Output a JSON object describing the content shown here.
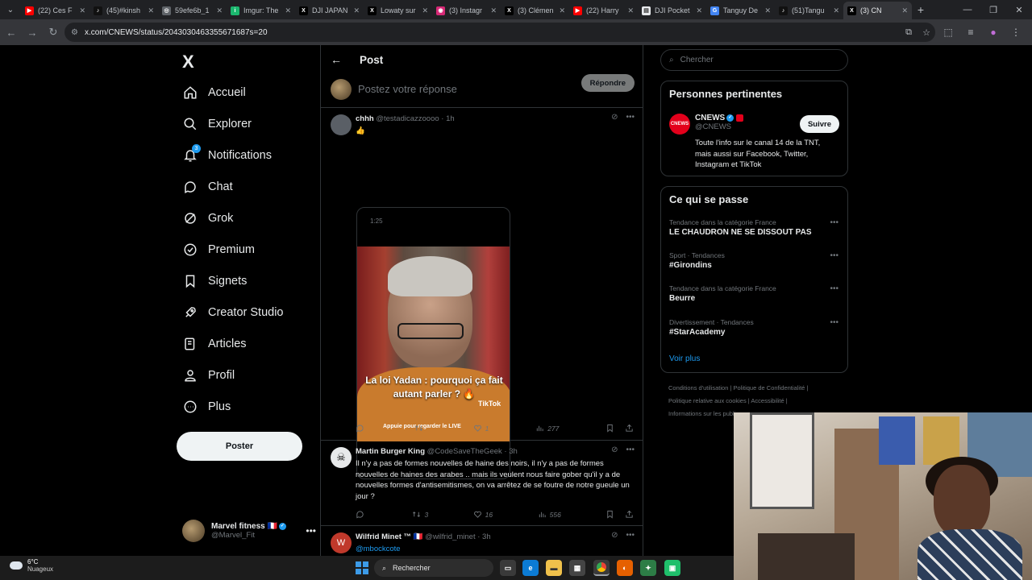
{
  "browser": {
    "tabs": [
      {
        "title": "(22) Ces F",
        "favicon": "youtube",
        "color": "#ff0000",
        "glyph": "▶"
      },
      {
        "title": "(45)#kinsh",
        "favicon": "tiktok",
        "color": "#111111",
        "glyph": "♪"
      },
      {
        "title": "59efe6b_1",
        "favicon": "globe",
        "color": "#5f6368",
        "glyph": "◎"
      },
      {
        "title": "Imgur: The",
        "favicon": "imgur",
        "color": "#1bb76e",
        "glyph": "i"
      },
      {
        "title": "DJI JAPAN",
        "favicon": "x",
        "color": "#000000",
        "glyph": "X"
      },
      {
        "title": "Lowaty sur",
        "favicon": "x",
        "color": "#000000",
        "glyph": "X"
      },
      {
        "title": "(3) Instagr",
        "favicon": "instagram",
        "color": "#d62976",
        "glyph": "◉"
      },
      {
        "title": "(3) Clémen",
        "favicon": "x",
        "color": "#000000",
        "glyph": "X"
      },
      {
        "title": "(22) Harry",
        "favicon": "youtube",
        "color": "#ff0000",
        "glyph": "▶"
      },
      {
        "title": "DJI Pocket",
        "favicon": "doc",
        "color": "#e8eaed",
        "glyph": "▤"
      },
      {
        "title": "Tanguy De",
        "favicon": "google",
        "color": "#4285f4",
        "glyph": "G"
      },
      {
        "title": "(51)Tangu",
        "favicon": "tiktok",
        "color": "#111111",
        "glyph": "♪"
      },
      {
        "title": "(3) CN",
        "favicon": "x",
        "color": "#000000",
        "glyph": "X",
        "active": true
      }
    ],
    "url": "x.com/CNEWS/status/2043030463355671687s=20",
    "new_tab": "+"
  },
  "nav": {
    "logo": "X",
    "notification_count": "3",
    "items": [
      {
        "label": "Accueil",
        "icon": "home-icon"
      },
      {
        "label": "Explorer",
        "icon": "search-icon"
      },
      {
        "label": "Notifications",
        "icon": "bell-icon"
      },
      {
        "label": "Chat",
        "icon": "chat-icon"
      },
      {
        "label": "Grok",
        "icon": "grok-icon"
      },
      {
        "label": "Premium",
        "icon": "premium-icon"
      },
      {
        "label": "Signets",
        "icon": "bookmark-icon"
      },
      {
        "label": "Creator Studio",
        "icon": "rocket-icon"
      },
      {
        "label": "Articles",
        "icon": "article-icon"
      },
      {
        "label": "Profil",
        "icon": "profile-icon"
      },
      {
        "label": "Plus",
        "icon": "more-icon"
      }
    ],
    "post_button": "Poster",
    "account": {
      "name": "Marvel fitness",
      "handle": "@Marvel_Fit",
      "flag": "🇫🇷"
    }
  },
  "center": {
    "header_title": "Post",
    "reply_placeholder": "Postez votre réponse",
    "reply_button": "Répondre",
    "tweets": [
      {
        "author": "chhh",
        "handle": "@testadicazzoooo",
        "time": "· 1h",
        "text": "👍",
        "video_duration": "1:25",
        "caption": "La loi Yadan : pourquoi ça fait autant parler ? 🔥",
        "tiktok_label": "TikTok",
        "live_label": "Appuie pour regarder le LIVE",
        "stats": {
          "replies": "",
          "reposts": "",
          "likes": "1",
          "views": "277"
        }
      },
      {
        "author": "Martin Burger King",
        "handle": "@CodeSaveTheGeek",
        "time": "· 3h",
        "text": "Il n'y a pas de formes nouvelles de haine des noirs, il n'y a pas de formes nouvelles de haines des arabes .. mais ils veulent nous faire gober qu'il y a de nouvelles formes d'antisemitismes, on va arrêtez de se foutre de notre gueule un jour ?",
        "stats": {
          "replies": "",
          "reposts": "3",
          "likes": "16",
          "views": "556"
        }
      },
      {
        "author": "Wilfrid Minet ™",
        "handle": "@wilfrid_minet",
        "time": "· 3h",
        "text": "@mbockcote",
        "avatar_letter": "W",
        "flag": "🇫🇷"
      }
    ]
  },
  "right": {
    "search_placeholder": "Chercher",
    "relevant": {
      "title": "Personnes pertinentes",
      "name": "CNEWS",
      "handle": "@CNEWS",
      "bio": "Toute l'info sur le canal 14 de la TNT, mais aussi sur Facebook, Twitter, Instagram et TikTok",
      "follow": "Suivre",
      "logo_text": "CNEWS"
    },
    "happening": {
      "title": "Ce qui se passe",
      "trends": [
        {
          "context": "Tendance dans la catégorie France",
          "name": "LE CHAUDRON NE SE DISSOUT PAS"
        },
        {
          "context": "Sport · Tendances",
          "name": "#Girondins"
        },
        {
          "context": "Tendance dans la catégorie France",
          "name": "Beurre"
        },
        {
          "context": "Divertissement · Tendances",
          "name": "#StarAcademy"
        }
      ],
      "see_more": "Voir plus"
    },
    "footer": {
      "line1": "Conditions d'utilisation  |  Politique de Confidentialité  |",
      "line2": "Politique relative aux cookies  |  Accessibilité  |",
      "line3": "Informations sur les publi"
    }
  },
  "taskbar": {
    "temp": "6°C",
    "weather": "Nuageux",
    "search": "Rechercher"
  },
  "colors": {
    "accent": "#1d9bf0",
    "background": "#000000",
    "border": "#2f3336"
  }
}
